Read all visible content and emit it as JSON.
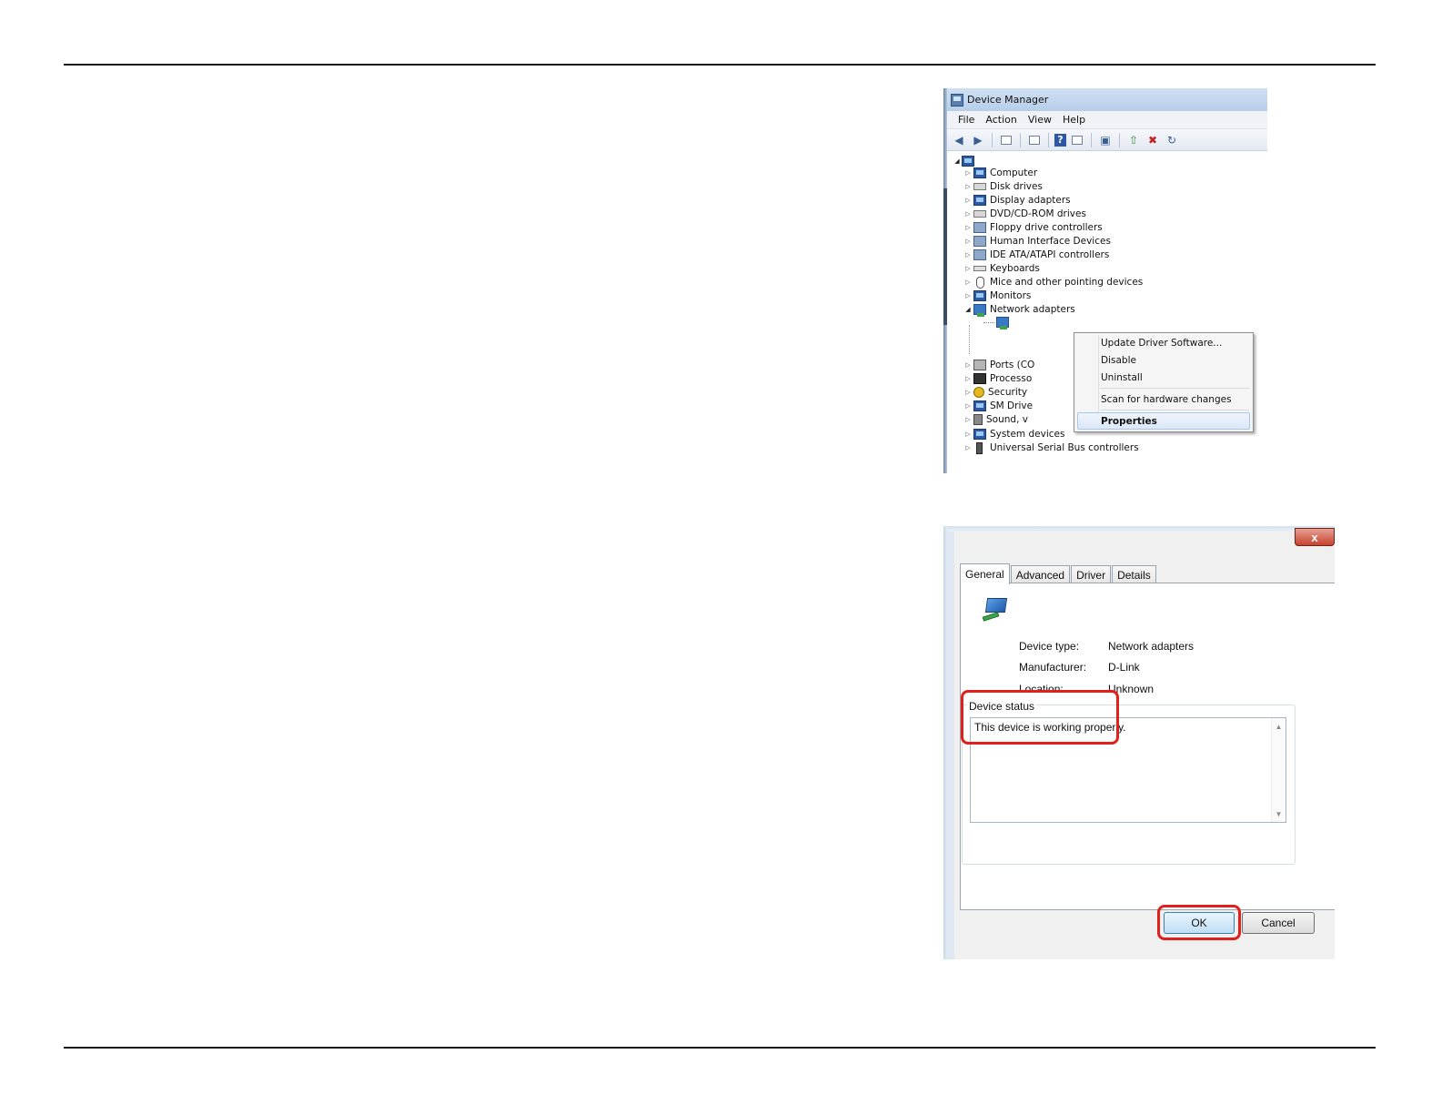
{
  "device_manager": {
    "title": "Device Manager",
    "menu": [
      "File",
      "Action",
      "View",
      "Help"
    ],
    "toolbar_icons": [
      "back-arrow-icon",
      "forward-arrow-icon",
      "show-hide-console-tree-icon",
      "properties-icon",
      "help-icon",
      "action-pane-icon",
      "scan-hardware-icon",
      "update-driver-icon",
      "uninstall-icon",
      "disable-icon"
    ],
    "tree_items": [
      "Computer",
      "Disk drives",
      "Display adapters",
      "DVD/CD-ROM drives",
      "Floppy drive controllers",
      "Human Interface Devices",
      "IDE ATA/ATAPI controllers",
      "Keyboards",
      "Mice and other pointing devices",
      "Monitors",
      "Network adapters",
      "Ports (CO",
      "Processo",
      "Security",
      "SM Drive",
      "Sound, v",
      "System devices",
      "Universal Serial Bus controllers"
    ],
    "context_menu": {
      "update": "Update Driver Software...",
      "disable": "Disable",
      "uninstall": "Uninstall",
      "scan": "Scan for hardware changes",
      "properties": "Properties"
    }
  },
  "properties_dialog": {
    "close_label": "x",
    "tabs": [
      "General",
      "Advanced",
      "Driver",
      "Details"
    ],
    "active_tab": "General",
    "device_type_label": "Device type:",
    "device_type_value": "Network adapters",
    "manufacturer_label": "Manufacturer:",
    "manufacturer_value": "D-Link",
    "location_label": "Location:",
    "location_value": "Unknown",
    "status_group_label": "Device status",
    "status_text": "This device is working properly.",
    "ok_label": "OK",
    "cancel_label": "Cancel",
    "highlight_color": "#e0201a"
  }
}
